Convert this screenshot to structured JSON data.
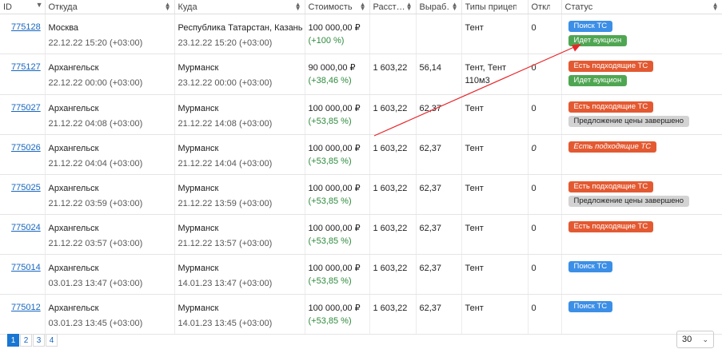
{
  "columns": [
    "ID",
    "Откуда",
    "Куда",
    "Стоимость",
    "Расст…",
    "Выраб…",
    "Типы прицепа",
    "Откли…",
    "Статус"
  ],
  "rows": [
    {
      "id": "775128",
      "from_city": "Москва",
      "from_date": "22.12.22 15:20 (+03:00)",
      "to_city": "Республика Татарстан, Казань",
      "to_date": "23.12.22 15:20 (+03:00)",
      "cost": "100 000,00 ₽",
      "cost_pct": "(+100 %)",
      "distance": "",
      "output": "",
      "trailer": "Тент",
      "trailer2": "",
      "responses": "0",
      "statuses": [
        {
          "text": "Поиск ТС",
          "color": "blue"
        },
        {
          "text": "Идет аукцион",
          "color": "green"
        }
      ]
    },
    {
      "id": "775127",
      "from_city": "Архангельск",
      "from_date": "22.12.22 00:00 (+03:00)",
      "to_city": "Мурманск",
      "to_date": "23.12.22 00:00 (+03:00)",
      "cost": "90 000,00 ₽",
      "cost_pct": "(+38,46 %)",
      "distance": "1 603,22",
      "output": "56,14",
      "trailer": "Тент, Тент",
      "trailer2": "110м3",
      "responses": "0",
      "statuses": [
        {
          "text": "Есть подходящие ТС",
          "color": "red"
        },
        {
          "text": "Идет аукцион",
          "color": "green"
        }
      ]
    },
    {
      "id": "775027",
      "from_city": "Архангельск",
      "from_date": "21.12.22 04:08 (+03:00)",
      "to_city": "Мурманск",
      "to_date": "21.12.22 14:08 (+03:00)",
      "cost": "100 000,00 ₽",
      "cost_pct": "(+53,85 %)",
      "distance": "1 603,22",
      "output": "62,37",
      "trailer": "Тент",
      "trailer2": "",
      "responses": "0",
      "statuses": [
        {
          "text": "Есть подходящие ТС",
          "color": "red"
        },
        {
          "text": "Предложение цены завершено",
          "color": "gray"
        }
      ]
    },
    {
      "id": "775026",
      "from_city": "Архангельск",
      "from_date": "21.12.22 04:04 (+03:00)",
      "to_city": "Мурманск",
      "to_date": "21.12.22 14:04 (+03:00)",
      "cost": "100 000,00 ₽",
      "cost_pct": "(+53,85 %)",
      "distance": "1 603,22",
      "output": "62,37",
      "trailer": "Тент",
      "trailer2": "",
      "responses": "0",
      "statuses": [
        {
          "text": "Есть подходящие ТС",
          "color": "red-italic"
        }
      ]
    },
    {
      "id": "775025",
      "from_city": "Архангельск",
      "from_date": "21.12.22 03:59 (+03:00)",
      "to_city": "Мурманск",
      "to_date": "21.12.22 13:59 (+03:00)",
      "cost": "100 000,00 ₽",
      "cost_pct": "(+53,85 %)",
      "distance": "1 603,22",
      "output": "62,37",
      "trailer": "Тент",
      "trailer2": "",
      "responses": "0",
      "statuses": [
        {
          "text": "Есть подходящие ТС",
          "color": "red"
        },
        {
          "text": "Предложение цены завершено",
          "color": "gray"
        }
      ]
    },
    {
      "id": "775024",
      "from_city": "Архангельск",
      "from_date": "21.12.22 03:57 (+03:00)",
      "to_city": "Мурманск",
      "to_date": "21.12.22 13:57 (+03:00)",
      "cost": "100 000,00 ₽",
      "cost_pct": "(+53,85 %)",
      "distance": "1 603,22",
      "output": "62,37",
      "trailer": "Тент",
      "trailer2": "",
      "responses": "0",
      "statuses": [
        {
          "text": "Есть подходящие ТС",
          "color": "red"
        }
      ]
    },
    {
      "id": "775014",
      "from_city": "Архангельск",
      "from_date": "03.01.23 13:47 (+03:00)",
      "to_city": "Мурманск",
      "to_date": "14.01.23 13:47 (+03:00)",
      "cost": "100 000,00 ₽",
      "cost_pct": "(+53,85 %)",
      "distance": "1 603,22",
      "output": "62,37",
      "trailer": "Тент",
      "trailer2": "",
      "responses": "0",
      "statuses": [
        {
          "text": "Поиск ТС",
          "color": "blue"
        }
      ]
    },
    {
      "id": "775012",
      "from_city": "Архангельск",
      "from_date": "03.01.23 13:45 (+03:00)",
      "to_city": "Мурманск",
      "to_date": "14.01.23 13:45 (+03:00)",
      "cost": "100 000,00 ₽",
      "cost_pct": "(+53,85 %)",
      "distance": "1 603,22",
      "output": "62,37",
      "trailer": "Тент",
      "trailer2": "",
      "responses": "0",
      "statuses": [
        {
          "text": "Поиск ТС",
          "color": "blue"
        }
      ]
    }
  ],
  "pagination": {
    "pages": [
      "1",
      "2",
      "3",
      "4"
    ],
    "active": "1",
    "per_page": "30"
  },
  "colors": {
    "link": "#1565c0",
    "positive": "#2e8b3d",
    "badge_blue": "#3c8fe6",
    "badge_green": "#4fa652",
    "badge_red": "#e35a32",
    "badge_gray": "#d3d3d3",
    "annotation_arrow": "#e8262a"
  }
}
